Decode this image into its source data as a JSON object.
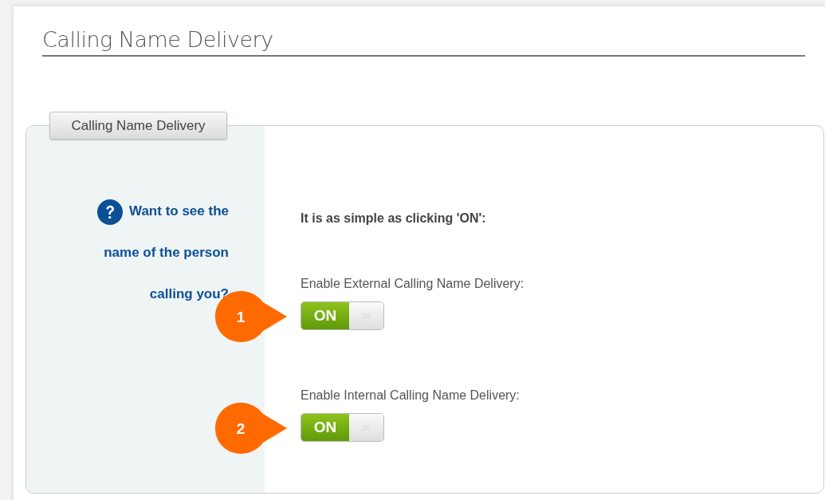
{
  "page": {
    "title": "Calling Name Delivery"
  },
  "section": {
    "legend": "Calling Name Delivery",
    "help": {
      "lines": [
        "Want to see the",
        "name of the person",
        "calling you?"
      ]
    },
    "intro": "It is as simple as clicking 'ON':",
    "settings": [
      {
        "label": "Enable External Calling Name Delivery:",
        "toggle": {
          "on": true,
          "text": "ON"
        },
        "callout": "1"
      },
      {
        "label": "Enable Internal Calling Name Delivery:",
        "toggle": {
          "on": true,
          "text": "ON"
        },
        "callout": "2"
      }
    ]
  }
}
